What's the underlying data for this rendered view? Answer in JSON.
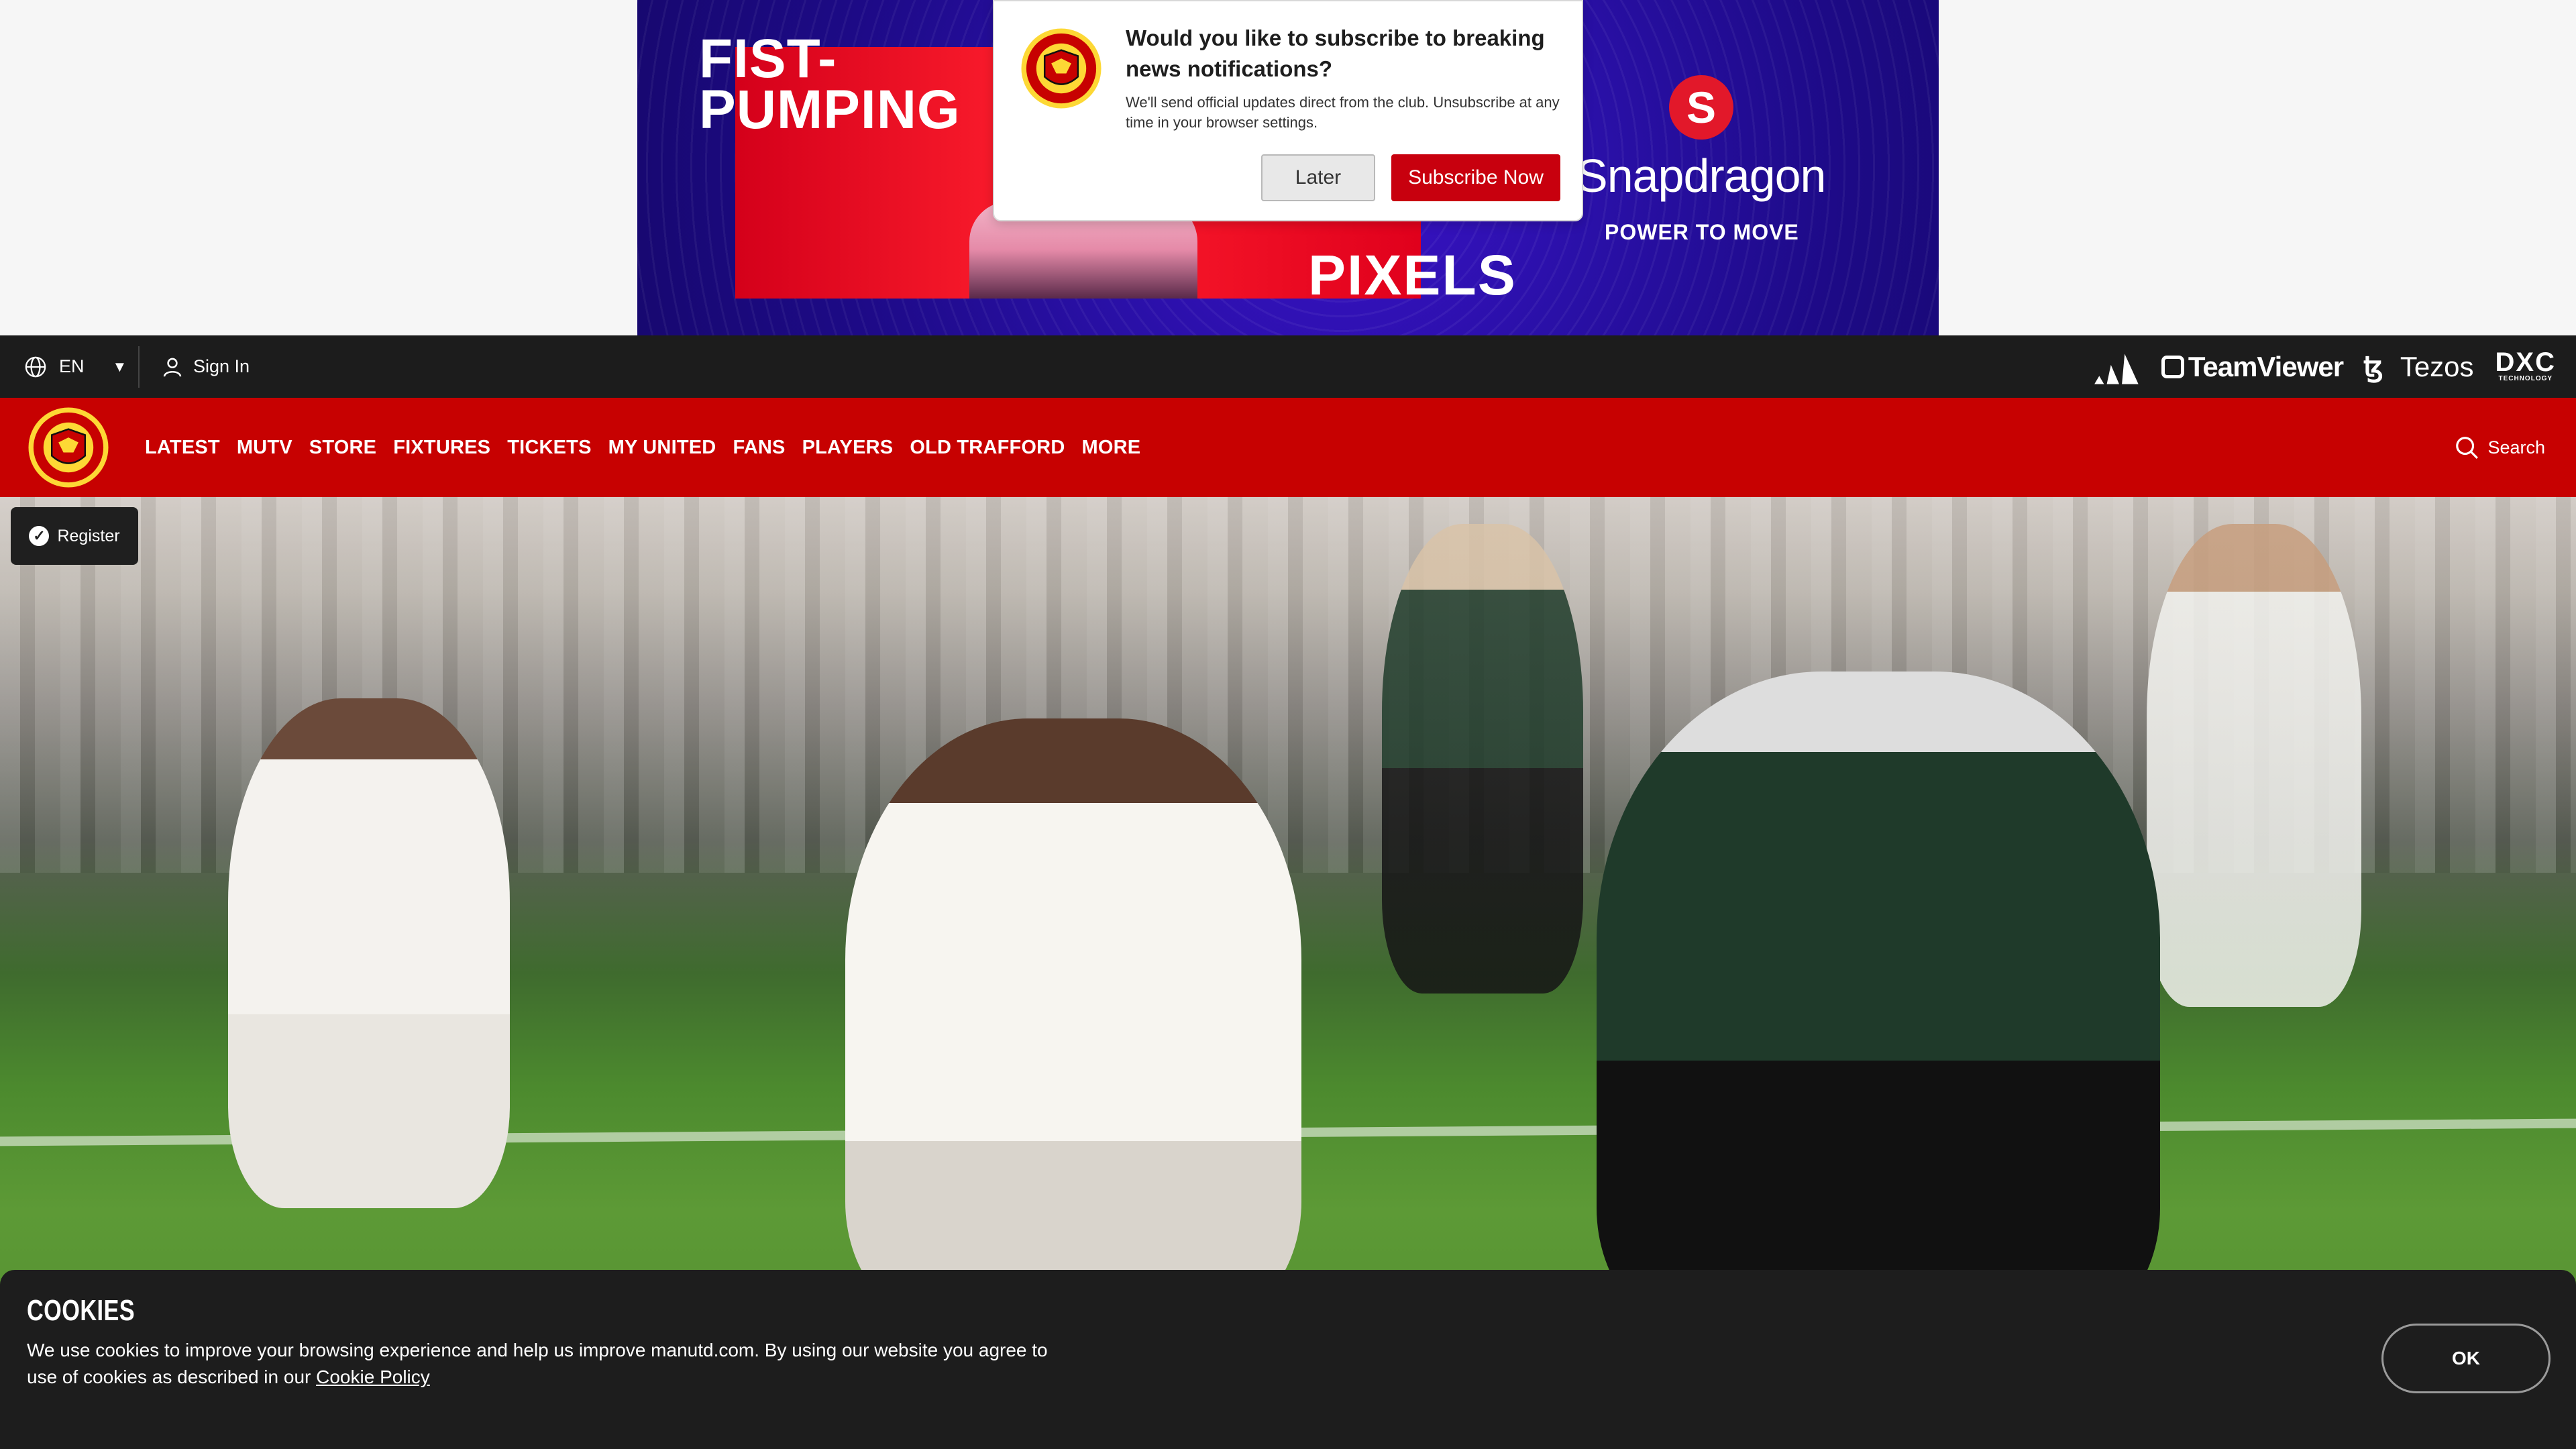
{
  "ad": {
    "headline": "FIST-PUMPING",
    "headline_line1": "FIST-",
    "headline_line2": "PUMPING",
    "pixels_text": "PIXELS",
    "brand": "Snapdragon",
    "tagline": "POWER TO MOVE",
    "colors": {
      "background": "#1d0a86",
      "panel": "#e0001c"
    }
  },
  "notification": {
    "title": "Would you like to subscribe to breaking news notifications?",
    "body": "We'll send official updates direct from the club. Unsubscribe at any time in your browser settings.",
    "later_label": "Later",
    "subscribe_label": "Subscribe Now"
  },
  "utility_bar": {
    "language": "EN",
    "sign_in": "Sign In",
    "sponsors": {
      "teamviewer": "TeamViewer",
      "tezos": "Tezos",
      "dxc": "DXC",
      "dxc_sub": "TECHNOLOGY"
    }
  },
  "main_nav": {
    "items": [
      "LATEST",
      "MUTV",
      "STORE",
      "FIXTURES",
      "TICKETS",
      "MY UNITED",
      "FANS",
      "PLAYERS",
      "OLD TRAFFORD",
      "MORE"
    ],
    "search_label": "Search",
    "accent_color": "#c70101"
  },
  "hero": {
    "register_label": "Register"
  },
  "cookie": {
    "title": "COOKIES",
    "text": "We use cookies to improve your browsing experience and help us improve manutd.com. By using our website you agree to use of cookies as described in our",
    "link_label": "Cookie Policy",
    "ok_label": "OK"
  }
}
